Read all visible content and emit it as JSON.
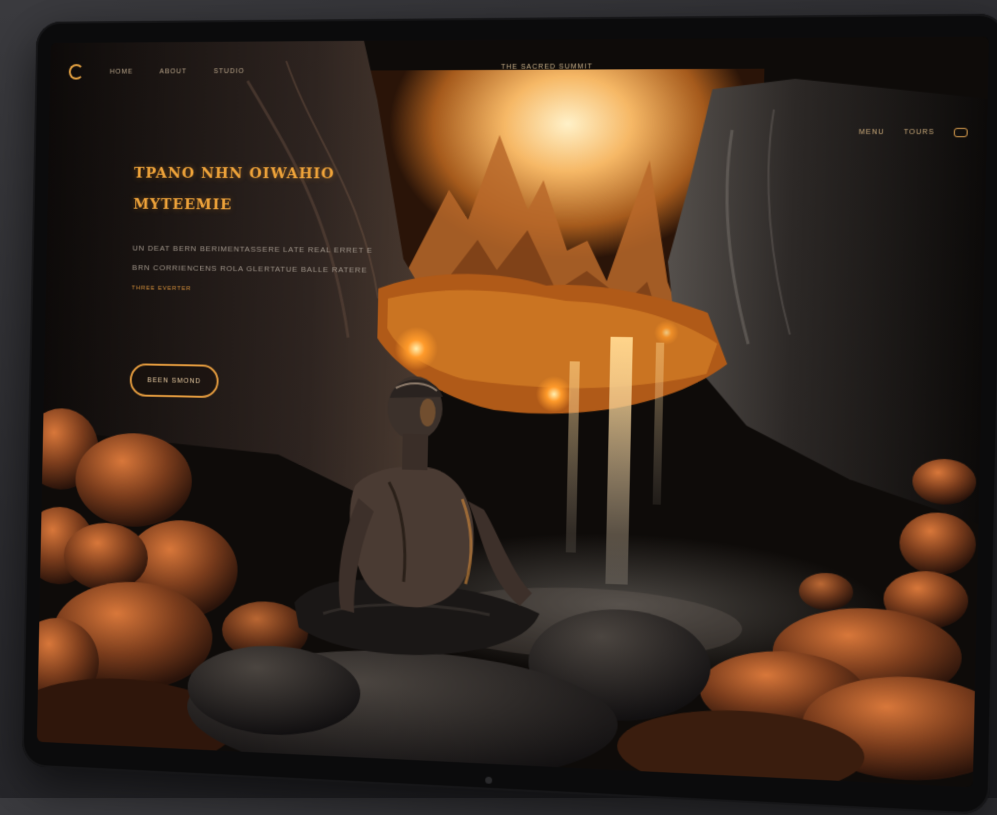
{
  "nav": {
    "links": [
      "HOME",
      "ABOUT",
      "STUDIO"
    ],
    "center_title": "THE SACRED SUMMIT",
    "right_links": [
      "MENU",
      "TOURS"
    ]
  },
  "hero": {
    "title_line1": "TPANO NHN OIWAHIO",
    "title_line2": "MYTEEMIE",
    "body_line1": "UN DEAT BERN BERIMENTASSERE LATE REAL ERRET E",
    "body_line2": "BRN CORRIENCENS ROLA GLERTATUE BALLE RATERE",
    "small_link": "THREE EVERTER",
    "cta_label": "BEEN SMOND"
  },
  "colors": {
    "accent": "#f0a43a",
    "glow": "#ff9a2a",
    "background": "#0e0b09"
  },
  "icons": [
    "logo-icon",
    "menu-icon"
  ]
}
